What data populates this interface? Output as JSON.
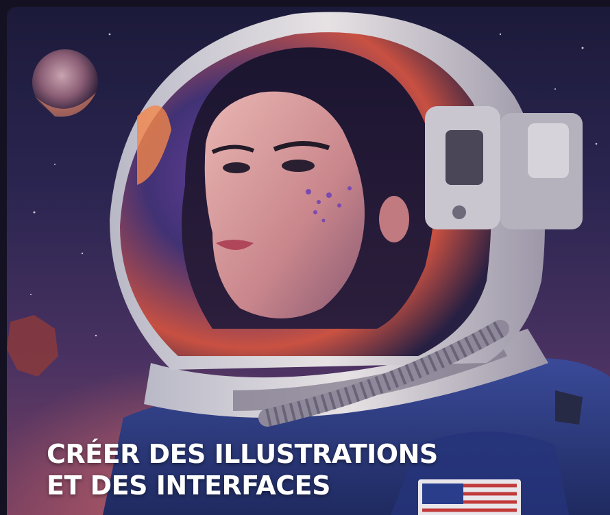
{
  "hero": {
    "image_alt": "astronaut-illustration",
    "caption_line1": "CRÉER DES ILLUSTRATIONS",
    "caption_line2": "ET DES INTERFACES"
  },
  "colors": {
    "background": "#141222",
    "caption_text": "#ffffff",
    "space_top": "#1c1a3a",
    "nebula_glow": "#f0786e",
    "helmet_shell": "#d9d6dc",
    "suit_blue": "#2d3f86"
  }
}
